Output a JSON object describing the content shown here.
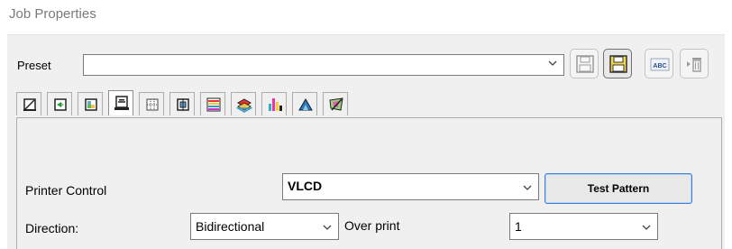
{
  "window": {
    "title": "Job Properties"
  },
  "preset": {
    "label": "Preset",
    "value": "",
    "toolbar": [
      {
        "icon": "save-disabled-icon"
      },
      {
        "icon": "save-as-icon"
      },
      {
        "icon": "rename-abc-icon"
      },
      {
        "icon": "delete-trash-icon"
      }
    ]
  },
  "tabs": [
    {
      "icon": "media-icon"
    },
    {
      "icon": "layout-arrows-icon"
    },
    {
      "icon": "image-icon"
    },
    {
      "icon": "printer-icon",
      "active": true
    },
    {
      "icon": "tiling-icon"
    },
    {
      "icon": "crop-marks-icon"
    },
    {
      "icon": "color-bars-icon"
    },
    {
      "icon": "layers-icon"
    },
    {
      "icon": "channels-icon"
    },
    {
      "icon": "ink-icon"
    },
    {
      "icon": "color-correction-icon"
    }
  ],
  "printer_control": {
    "label": "Printer Control",
    "value": "VLCD",
    "test_pattern_label": "Test Pattern"
  },
  "direction": {
    "label": "Direction:",
    "value": "Bidirectional"
  },
  "over_print": {
    "label": "Over print",
    "value": "1"
  }
}
